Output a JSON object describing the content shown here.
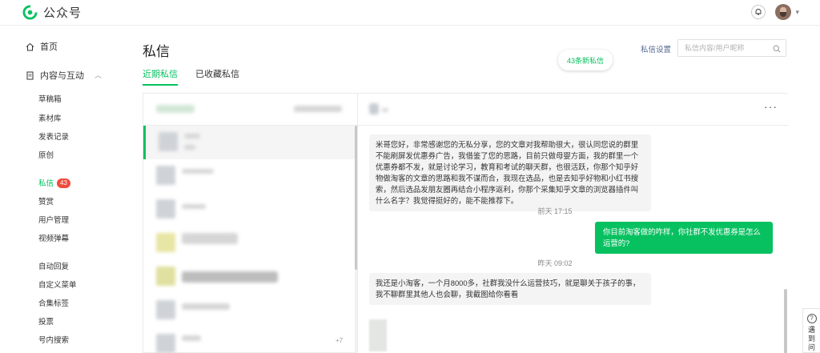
{
  "header": {
    "app_title": "公众号",
    "colors": {
      "brand": "#07c160"
    }
  },
  "sidebar": {
    "home": "首页",
    "content_group": "内容与互动",
    "items": [
      {
        "label": "草稿箱"
      },
      {
        "label": "素材库"
      },
      {
        "label": "发表记录"
      },
      {
        "label": "原创"
      },
      {
        "label": "私信",
        "badge": "43",
        "active": true
      },
      {
        "label": "赞赏"
      },
      {
        "label": "用户管理"
      },
      {
        "label": "视频弹幕"
      },
      {
        "label": "自动回复"
      },
      {
        "label": "自定义菜单"
      },
      {
        "label": "合集标签"
      },
      {
        "label": "投票"
      },
      {
        "label": "号内搜索"
      }
    ]
  },
  "main": {
    "title": "私信",
    "new_messages": "43条新私信",
    "tabs": [
      {
        "label": "近期私信",
        "active": true
      },
      {
        "label": "已收藏私信"
      }
    ],
    "settings_label": "私信设置",
    "search_placeholder": "私信内容/用户昵称"
  },
  "list_badge": "+7",
  "chat": {
    "messages": [
      {
        "direction": "in",
        "text": "米哥您好，非常感谢您的无私分享，您的文章对我帮助很大，很认同您说的群里不能刷屏发优惠券广告，我借鉴了您的思路，目前只做母婴方面，我的群里一个优惠券都不发，就是讨论学习，教育和考试的聊天群，也很活跃，你那个知乎好物做淘客的文章的思路和我不谋而合，我现在选品，也是去知乎好物和小红书搜索，然后选品发朋友圈再结合小程序返利，你那个采集知乎文章的浏览器插件叫什么名字？我觉得挺好的，能不能推荐下。"
      },
      {
        "type": "time",
        "text": "前天 17:15"
      },
      {
        "direction": "out",
        "text": "你目前淘客做的咋样，你社群不发优惠券是怎么运营的?"
      },
      {
        "type": "time",
        "text": "昨天 09:02"
      },
      {
        "direction": "in",
        "text": "我还是小淘客，一个月8000多，社群我没什么运营技巧，就是聊关于孩子的事，我不聊群里其他人也会聊，我截图给你看看"
      }
    ]
  },
  "float_help": {
    "text": "遇到问"
  }
}
